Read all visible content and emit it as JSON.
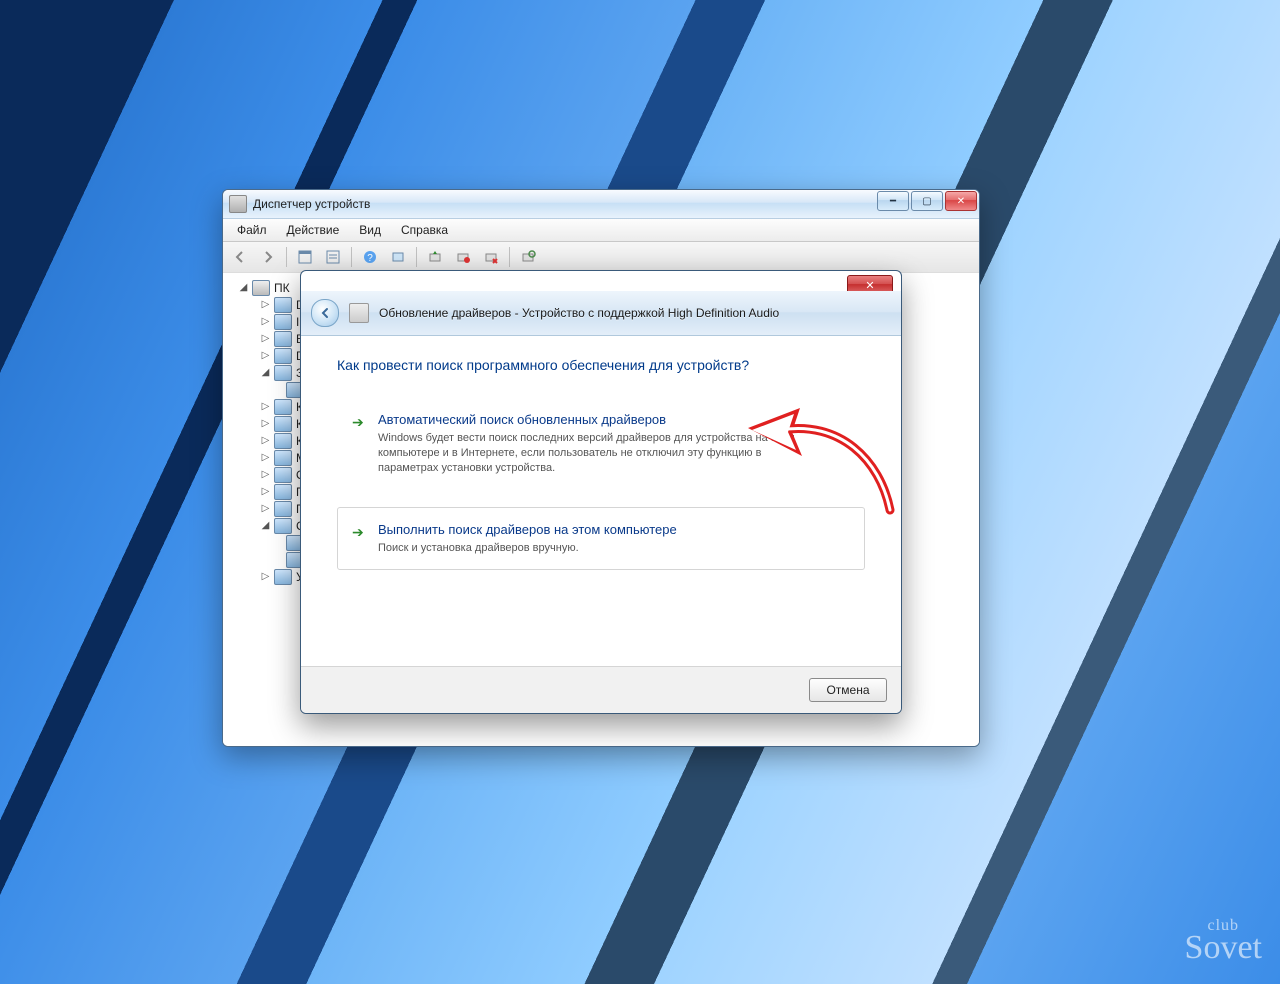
{
  "devmgr": {
    "title": "Диспетчер устройств",
    "menus": {
      "file": "Файл",
      "action": "Действие",
      "view": "Вид",
      "help": "Справка"
    },
    "tree": {
      "root": "ПК",
      "items": [
        "D",
        "ID",
        "B",
        "D",
        "З",
        "",
        "К",
        "К",
        "К",
        "М",
        "О",
        "П",
        "П",
        "С",
        "",
        "",
        "У"
      ]
    }
  },
  "dialog": {
    "title": "Обновление драйверов - Устройство с поддержкой High Definition Audio",
    "heading": "Как провести поиск программного обеспечения для устройств?",
    "option1": {
      "title": "Автоматический поиск обновленных драйверов",
      "desc": "Windows будет вести поиск последних версий драйверов для устройства на этом компьютере и в Интернете, если пользователь не отключил эту функцию в параметрах установки устройства."
    },
    "option2": {
      "title": "Выполнить поиск драйверов на этом компьютере",
      "desc": "Поиск и установка драйверов вручную."
    },
    "cancel": "Отмена"
  },
  "watermark": {
    "small": "club",
    "big": "Sovet"
  }
}
